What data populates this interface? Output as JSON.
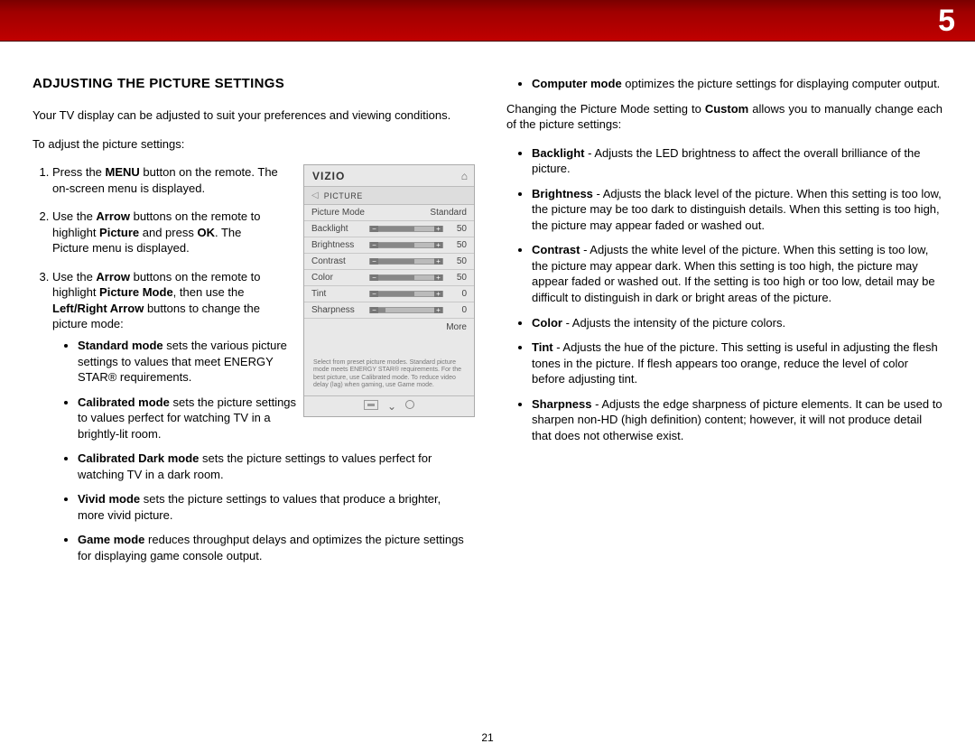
{
  "chapter": "5",
  "page_number": "21",
  "heading": "ADJUSTING THE PICTURE SETTINGS",
  "intro": "Your TV display can be adjusted to suit your preferences and viewing conditions.",
  "lead_in": "To adjust the picture settings:",
  "step1_a": "Press the ",
  "step1_b": "MENU",
  "step1_c": " button on the remote. The on-screen menu is displayed.",
  "step2_a": "Use the ",
  "step2_b": "Arrow",
  "step2_c": " buttons on the remote to highlight ",
  "step2_d": "Picture",
  "step2_e": " and press ",
  "step2_f": "OK",
  "step2_g": ". The Picture menu is displayed.",
  "step3_a": "Use the ",
  "step3_b": "Arrow",
  "step3_c": " buttons on the remote to highlight ",
  "step3_d": "Picture Mode",
  "step3_e": ", then use the ",
  "step3_f": "Left/Right Arrow",
  "step3_g": " buttons to change the picture mode:",
  "modes": {
    "std_b": "Standard mode",
    "std_t": " sets the various picture settings to values that meet ENERGY STAR® requirements.",
    "cal_b": "Calibrated mode",
    "cal_t": " sets the picture settings to values perfect for watching TV in a brightly-lit room.",
    "cald_b": "Calibrated Dark mode",
    "cald_t": " sets the picture settings to values perfect for watching TV in a dark room.",
    "viv_b": "Vivid mode",
    "viv_t": " sets the picture settings to values that produce a brighter, more vivid picture.",
    "game_b": "Game mode",
    "game_t": " reduces throughput delays and optimizes the picture settings for displaying game console output.",
    "comp_b": "Computer mode",
    "comp_t": " optimizes the picture settings for displaying computer output."
  },
  "custom_a": "Changing the Picture Mode setting to ",
  "custom_b": "Custom",
  "custom_c": " allows you to manually change each of the picture settings:",
  "settings": {
    "bl_b": "Backlight",
    "bl_t": " - Adjusts the LED brightness to affect the overall brilliance of the picture.",
    "br_b": "Brightness",
    "br_t": " - Adjusts the black level of the picture. When this setting is too low, the picture may be too dark to distinguish details. When this setting is too high, the picture may appear faded or washed out.",
    "ct_b": "Contrast",
    "ct_t": " - Adjusts the white level of the picture. When this setting is too low, the picture may appear dark. When this setting is too high, the picture may appear faded or washed out. If the setting is too high or too low, detail may be difficult to distinguish in dark or bright areas of the picture.",
    "co_b": "Color",
    "co_t": " - Adjusts the intensity of the picture colors.",
    "ti_b": "Tint",
    "ti_t": " - Adjusts the hue of the picture. This setting is useful in adjusting the flesh tones in the picture. If flesh appears too orange, reduce the level of color before adjusting tint.",
    "sh_b": "Sharpness",
    "sh_t": " - Adjusts the edge sharpness of picture elements. It can be used to sharpen non-HD (high definition) content; however, it will not produce detail that does not otherwise exist."
  },
  "osd": {
    "logo": "VIZIO",
    "title": "PICTURE",
    "pm_label": "Picture Mode",
    "pm_value": "Standard",
    "rows": [
      {
        "label": "Backlight",
        "val": "50",
        "fill": 50
      },
      {
        "label": "Brightness",
        "val": "50",
        "fill": 50
      },
      {
        "label": "Contrast",
        "val": "50",
        "fill": 50
      },
      {
        "label": "Color",
        "val": "50",
        "fill": 50
      },
      {
        "label": "Tint",
        "val": "0",
        "fill": 50
      },
      {
        "label": "Sharpness",
        "val": "0",
        "fill": 10
      }
    ],
    "more": "More",
    "note": "Select from preset picture modes. Standard picture mode meets ENERGY STAR® requirements. For the best picture, use Calibrated mode. To reduce video delay (lag) when gaming, use Game mode."
  }
}
